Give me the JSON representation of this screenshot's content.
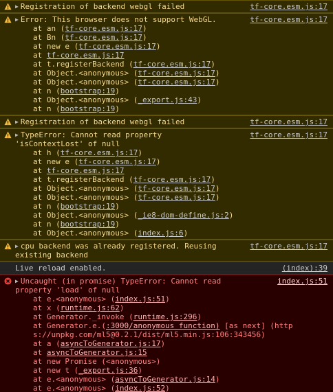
{
  "entries": [
    {
      "level": "warn",
      "message": "Registration of backend webgl failed",
      "source": "tf-core.esm.js:17"
    },
    {
      "level": "warn",
      "message": "Error: This browser does not support WebGL.",
      "source": "tf-core.esm.js:17",
      "frames": [
        {
          "pre": "at an (",
          "link": "tf-core.esm.js:17",
          "post": ")"
        },
        {
          "pre": "at Bn (",
          "link": "tf-core.esm.js:17",
          "post": ")"
        },
        {
          "pre": "at new e (",
          "link": "tf-core.esm.js:17",
          "post": ")"
        },
        {
          "pre": "at ",
          "link": "tf-core.esm.js:17",
          "post": ""
        },
        {
          "pre": "at t.registerBackend (",
          "link": "tf-core.esm.js:17",
          "post": ")"
        },
        {
          "pre": "at Object.<anonymous> (",
          "link": "tf-core.esm.js:17",
          "post": ")"
        },
        {
          "pre": "at Object.<anonymous> (",
          "link": "tf-core.esm.js:17",
          "post": ")"
        },
        {
          "pre": "at n (",
          "link": "bootstrap:19",
          "post": ")"
        },
        {
          "pre": "at Object.<anonymous> (",
          "link": "_export.js:43",
          "post": ")"
        },
        {
          "pre": "at n (",
          "link": "bootstrap:19",
          "post": ")"
        }
      ]
    },
    {
      "level": "warn",
      "message": "Registration of backend webgl failed",
      "source": "tf-core.esm.js:17"
    },
    {
      "level": "warn",
      "message": "TypeError: Cannot read property\n'isContextLost' of null",
      "source": "tf-core.esm.js:17",
      "frames": [
        {
          "pre": "at h (",
          "link": "tf-core.esm.js:17",
          "post": ")"
        },
        {
          "pre": "at new e (",
          "link": "tf-core.esm.js:17",
          "post": ")"
        },
        {
          "pre": "at ",
          "link": "tf-core.esm.js:17",
          "post": ""
        },
        {
          "pre": "at t.registerBackend (",
          "link": "tf-core.esm.js:17",
          "post": ")"
        },
        {
          "pre": "at Object.<anonymous> (",
          "link": "tf-core.esm.js:17",
          "post": ")"
        },
        {
          "pre": "at Object.<anonymous> (",
          "link": "tf-core.esm.js:17",
          "post": ")"
        },
        {
          "pre": "at n (",
          "link": "bootstrap:19",
          "post": ")"
        },
        {
          "pre": "at Object.<anonymous> (",
          "link": "_ie8-dom-define.js:2",
          "post": ")"
        },
        {
          "pre": "at n (",
          "link": "bootstrap:19",
          "post": ")"
        },
        {
          "pre": "at Object.<anonymous> (",
          "link": "index.js:6",
          "post": ")"
        }
      ]
    },
    {
      "level": "warn",
      "message": "cpu backend was already registered. Reusing\nexisting backend",
      "source": "tf-core.esm.js:17"
    },
    {
      "level": "info",
      "message": "Live reload enabled.",
      "source": "(index):39"
    },
    {
      "level": "error",
      "message": "Uncaught (in promise) TypeError: Cannot read\nproperty 'load' of null",
      "source": "index.js:51",
      "frames": [
        {
          "pre": "at e.<anonymous> (",
          "link": "index.js:51",
          "post": ")"
        },
        {
          "pre": "at x (",
          "link": "runtime.js:62",
          "post": ")"
        },
        {
          "pre": "at Generator._invoke (",
          "link": "runtime.js:296",
          "post": ")"
        },
        {
          "pre": "at Generator.e.(",
          "link": ":3000/anonymous function)",
          "post": " [as next] (http\ns://unpkg.com/ml5@0.2.1/dist/ml5.min.js:106:343456)",
          "wrap": true
        },
        {
          "pre": "at a (",
          "link": "asyncToGenerator.js:17",
          "post": ")"
        },
        {
          "pre": "at ",
          "link": "asyncToGenerator.js:15",
          "post": ""
        },
        {
          "pre": "at new Promise (<anonymous>)",
          "link": "",
          "post": ""
        },
        {
          "pre": "at new t (",
          "link": "_export.js:36",
          "post": ")"
        },
        {
          "pre": "at e.<anonymous> (",
          "link": "asyncToGenerator.js:14",
          "post": ")"
        },
        {
          "pre": "at e.<anonymous> (",
          "link": "index.js:52",
          "post": ")"
        }
      ]
    }
  ],
  "icons": {
    "warn": "warning-triangle-icon",
    "error": "error-circle-icon",
    "expand": "disclosure-triangle-icon"
  },
  "colors": {
    "warn_bg": "#332b00",
    "warn_text": "#f5d88a",
    "error_bg": "#290000",
    "error_text": "#ff8080",
    "info_bg": "#242424",
    "warn_icon": "#f4bd3e",
    "error_icon": "#e8403a"
  }
}
